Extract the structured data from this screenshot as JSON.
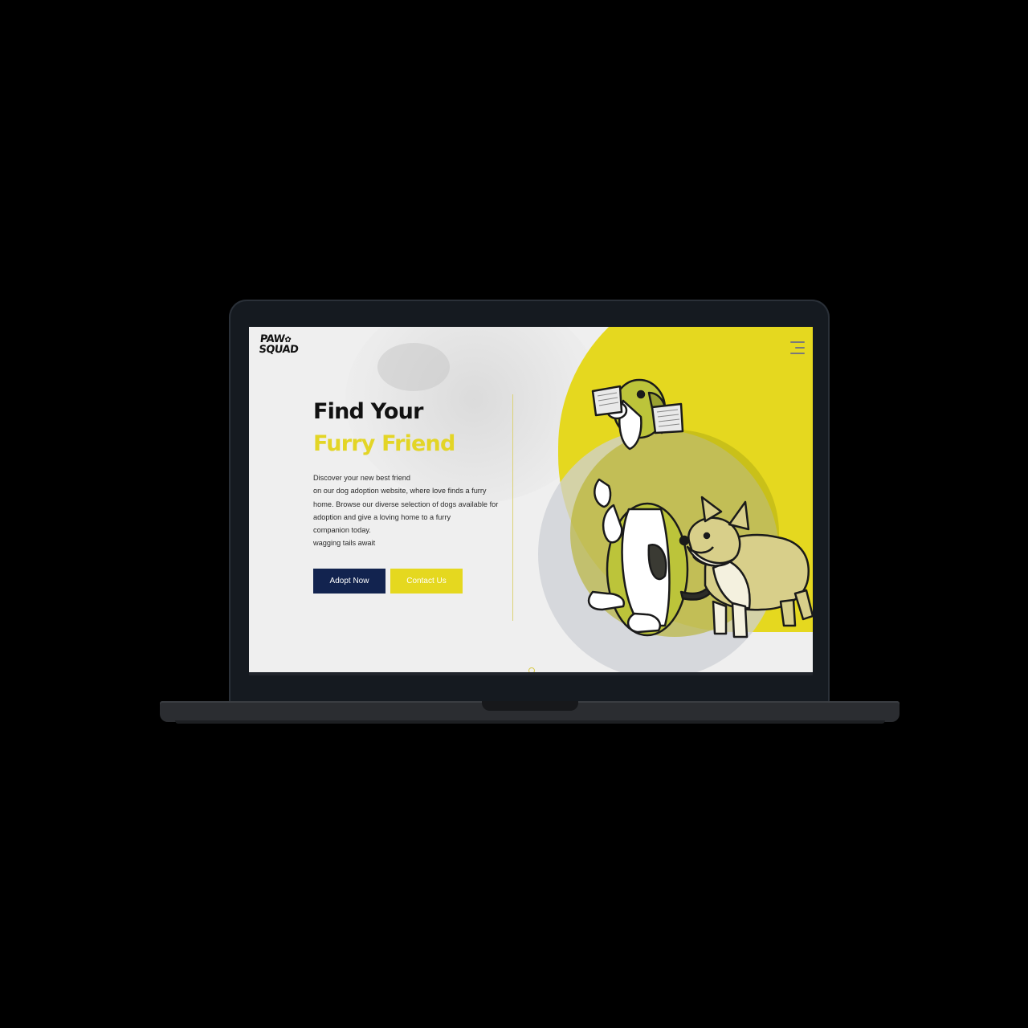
{
  "brand": {
    "logo_line1": "PAW",
    "logo_line2": "SQUAD"
  },
  "hero": {
    "title_line1": "Find Your",
    "title_line2": "Furry Friend",
    "description": [
      "Discover your new best friend",
      "on our dog adoption website, where love finds a furry",
      "home. Browse our diverse selection of dogs available for",
      "adoption and give a loving home to a furry",
      "companion today.",
      "wagging tails await"
    ]
  },
  "buttons": {
    "adopt_label": "Adopt Now",
    "contact_label": "Contact Us"
  },
  "icons": {
    "menu": "hamburger-menu-icon",
    "logo_mark": "paw-icon"
  },
  "colors": {
    "accent": "#e5d81f",
    "primary": "#12234f",
    "background": "#efefef",
    "device": "#151a20"
  }
}
